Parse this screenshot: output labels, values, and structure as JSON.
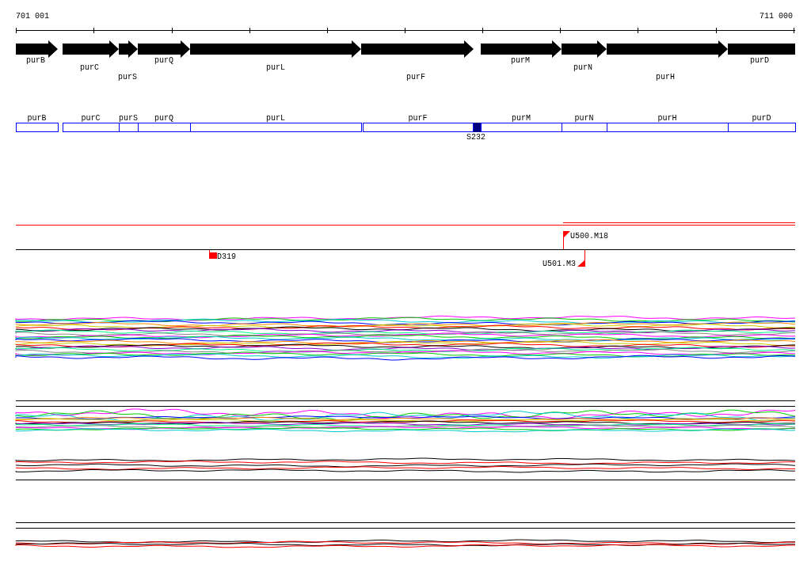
{
  "ruler": {
    "start_label": "701 001",
    "end_label": "711 000"
  },
  "genes": [
    {
      "name": "purB"
    },
    {
      "name": "purC"
    },
    {
      "name": "purS"
    },
    {
      "name": "purQ"
    },
    {
      "name": "purL"
    },
    {
      "name": "purF"
    },
    {
      "name": "purM"
    },
    {
      "name": "purN"
    },
    {
      "name": "purH"
    },
    {
      "name": "purD"
    }
  ],
  "feature_boxes": [
    {
      "label": "purB"
    },
    {
      "label": "purC"
    },
    {
      "label": "purS"
    },
    {
      "label": "purQ"
    },
    {
      "label": "purL"
    },
    {
      "label": "purF"
    },
    {
      "label": "purM"
    },
    {
      "label": "purN"
    },
    {
      "label": "purH"
    },
    {
      "label": "purD"
    }
  ],
  "markers": [
    {
      "label": "S232",
      "color": "#000080"
    },
    {
      "label": "D319",
      "color": "#ff0000"
    },
    {
      "label": "U500.M18",
      "color": "#ff0000"
    },
    {
      "label": "U501.M3",
      "color": "#ff0000"
    }
  ]
}
